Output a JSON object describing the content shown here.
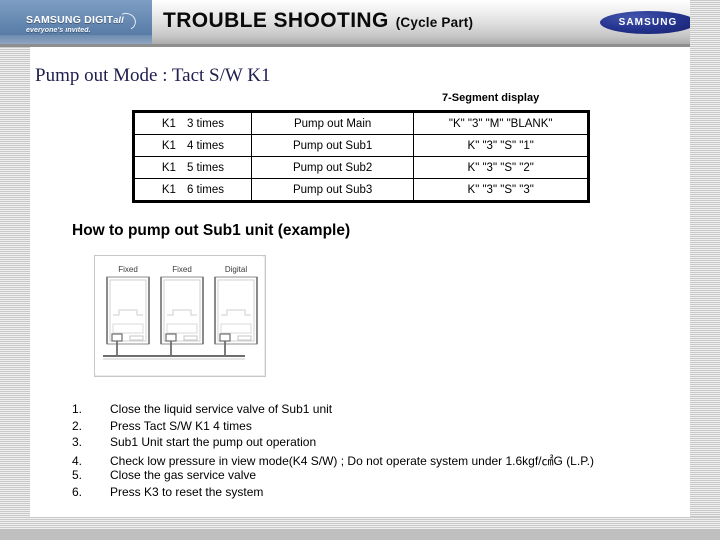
{
  "header": {
    "title_main": "TROUBLE SHOOTING",
    "title_sub": "(Cycle Part)",
    "logo_left_line1": "SAMSUNG DIGIT",
    "logo_left_line1_tail": "all",
    "logo_left_line2": "everyone's invited.",
    "logo_right": "SAMSUNG",
    "swoosh_icon": "swoosh-icon"
  },
  "content": {
    "section_heading": "Pump out Mode : Tact S/W K1",
    "segment_caption": "7-Segment display",
    "example_heading": "How to pump out Sub1 unit (example)"
  },
  "table": {
    "rows": [
      {
        "key": "K1",
        "count": "3 times",
        "action": "Pump out Main",
        "segment": "\"K\" \"3\" \"M\" \"BLANK\""
      },
      {
        "key": "K1",
        "count": "4 times",
        "action": "Pump out Sub1",
        "segment": "K\" \"3\" \"S\" \"1\""
      },
      {
        "key": "K1",
        "count": "5 times",
        "action": "Pump out Sub2",
        "segment": "K\" \"3\" \"S\" \"2\""
      },
      {
        "key": "K1",
        "count": "6 times",
        "action": "Pump out Sub3",
        "segment": "K\" \"3\" \"S\" \"3\""
      }
    ]
  },
  "diagram": {
    "unit_labels": [
      "Fixed",
      "Fixed",
      "Digital"
    ]
  },
  "steps": [
    {
      "num": "1.",
      "text": "Close the liquid service valve of Sub1 unit"
    },
    {
      "num": "2.",
      "text": "Press Tact S/W K1 4 times"
    },
    {
      "num": "3.",
      "text": "Sub1 Unit start the pump out operation"
    },
    {
      "num": "4.",
      "text": "Check low pressure in view mode(K4 S/W) ; Do not operate system under 1.6kgf/㎠G (L.P.)"
    },
    {
      "num": "5.",
      "text": "Close the gas service valve"
    },
    {
      "num": "6.",
      "text": "Press K3 to reset the system"
    }
  ]
}
